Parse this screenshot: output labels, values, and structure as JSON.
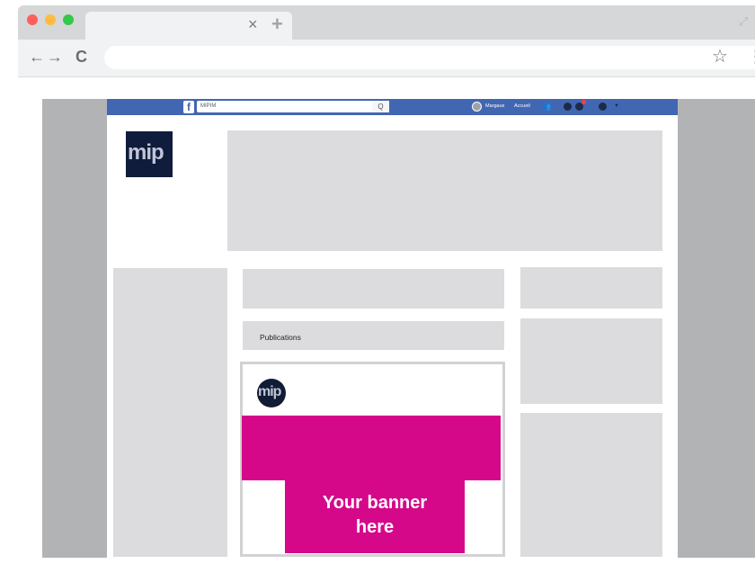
{
  "browser": {
    "tab_close_glyph": "×",
    "new_tab_glyph": "+",
    "back_glyph": "←",
    "forward_glyph": "→",
    "reload_glyph": "C",
    "bookmark_glyph": "☆",
    "menu_glyph": "⋮",
    "expand_glyph": "⤢",
    "traffic_lights": [
      "#fc605c",
      "#fdbc40",
      "#34c84a"
    ],
    "icons": [
      "close-icon",
      "back-arrow-icon",
      "forward-arrow-icon",
      "reload-icon",
      "star-icon",
      "menu-icon",
      "expand-icon"
    ]
  },
  "facebook_bar": {
    "logo": "f",
    "search_value": "MIPIM",
    "search_icon": "Q",
    "user_name": "Margaux",
    "home_label": "Accueil",
    "icons": [
      "friends-icon",
      "messenger-icon",
      "notifications-icon",
      "help-icon",
      "dropdown-icon"
    ],
    "bar_color": "#4267b2"
  },
  "page": {
    "logo_text": "mip",
    "publications_label": "Publications",
    "post_logo_text": "mip",
    "banner_text_line1": "Your banner",
    "banner_text_line2": "here",
    "banner_color": "#d6088a",
    "placeholder_color": "#dcdcde"
  }
}
